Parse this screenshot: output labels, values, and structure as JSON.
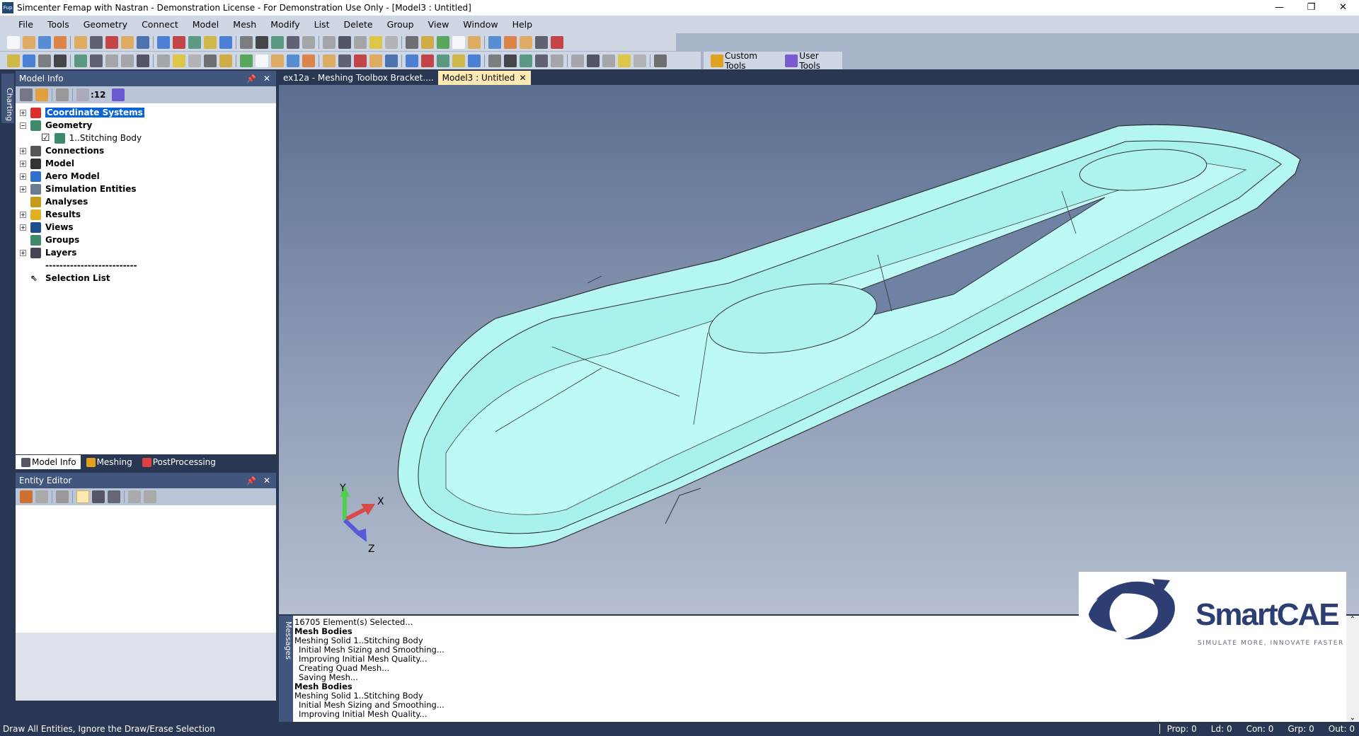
{
  "window": {
    "title": "Simcenter Femap with Nastran - Demonstration License - For Demonstration Use Only - [Model3 : Untitled]",
    "app_icon": "Fup"
  },
  "menu": [
    "File",
    "Tools",
    "Geometry",
    "Connect",
    "Model",
    "Mesh",
    "Modify",
    "List",
    "Delete",
    "Group",
    "View",
    "Window",
    "Help"
  ],
  "toolbar": {
    "custom_tools": "Custom Tools",
    "user_tools": "User Tools"
  },
  "side_tab": "Charting",
  "model_info": {
    "title": "Model Info",
    "count_label": ":12",
    "tree": [
      {
        "label": "Coordinate Systems",
        "expand": "+",
        "selected": true,
        "color": "#d9312b"
      },
      {
        "label": "Geometry",
        "expand": "−",
        "color": "#3e8a6a"
      },
      {
        "label": "1..Stitching Body",
        "child": true,
        "checked": true,
        "color": "#3e8a6a"
      },
      {
        "label": "Connections",
        "expand": "+",
        "color": "#555"
      },
      {
        "label": "Model",
        "expand": "+",
        "color": "#333"
      },
      {
        "label": "Aero Model",
        "expand": "+",
        "color": "#2f6fd0"
      },
      {
        "label": "Simulation Entities",
        "expand": "+",
        "color": "#6a7a90"
      },
      {
        "label": "Analyses",
        "color": "#c89a1a"
      },
      {
        "label": "Results",
        "expand": "+",
        "color": "#e0b020"
      },
      {
        "label": "Views",
        "expand": "+",
        "color": "#1f4b8f"
      },
      {
        "label": "Groups",
        "color": "#3e8a6a"
      },
      {
        "label": "Layers",
        "expand": "+",
        "color": "#445"
      },
      {
        "label": "--------------------------",
        "color": ""
      },
      {
        "label": "Selection List",
        "color": ""
      }
    ]
  },
  "panel_tabs": [
    "Model Info",
    "Meshing",
    "PostProcessing"
  ],
  "entity_editor": {
    "title": "Entity Editor"
  },
  "doc_tabs": [
    {
      "label": "ex12a - Meshing Toolbox Bracket...."
    },
    {
      "label": "Model3 : Untitled",
      "active": true
    }
  ],
  "triad": {
    "x": "X",
    "y": "Y",
    "z": "Z"
  },
  "logo": {
    "name": "SmartCAE",
    "tagline": "SIMULATE MORE, INNOVATE FASTER"
  },
  "messages": {
    "title": "Messages",
    "lines": [
      {
        "t": "16705 Element(s) Selected..."
      },
      {
        "t": "Mesh Bodies",
        "b": true
      },
      {
        "t": "Meshing Solid 1..Stitching Body"
      },
      {
        "t": "Initial Mesh Sizing and Smoothing...",
        "in": true
      },
      {
        "t": "Improving Initial Mesh Quality...",
        "in": true
      },
      {
        "t": "Creating Quad Mesh...",
        "in": true
      },
      {
        "t": "Saving Mesh...",
        "in": true
      },
      {
        "t": "Mesh Bodies",
        "b": true
      },
      {
        "t": "Meshing Solid 1..Stitching Body"
      },
      {
        "t": "Initial Mesh Sizing and Smoothing...",
        "in": true
      },
      {
        "t": "Improving Initial Mesh Quality...",
        "in": true
      }
    ]
  },
  "status": {
    "text": "Draw All Entities, Ignore the Draw/Erase Selection",
    "prop": "Prop: 0",
    "ld": "Ld: 0",
    "con": "Con: 0",
    "grp": "Grp: 0",
    "out": "Out: 0"
  },
  "colors": {
    "model_surface": "#b4f7f2",
    "viewport_top": "#5b6e90",
    "viewport_bottom": "#b5bfd0",
    "selection": "#0a64d6"
  }
}
